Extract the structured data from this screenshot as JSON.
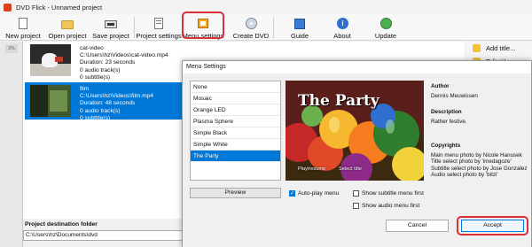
{
  "window": {
    "title": "DVD Flick - Unnamed project"
  },
  "toolbar": {
    "new_project": "New project",
    "open_project": "Open project",
    "save_project": "Save project",
    "project_settings": "Project settings",
    "menu_settings": "Menu settings",
    "create_dvd": "Create DVD",
    "guide": "Guide",
    "about": "About",
    "update": "Update"
  },
  "strip": {
    "marker": "2%"
  },
  "titles": [
    {
      "name": "cat-video",
      "path": "C:\\Users\\hz\\Videos\\cat-video.mp4",
      "duration": "Duration: 23 seconds",
      "audio": "0 audio track(s)",
      "subtitle": "0 subtitle(s)"
    },
    {
      "name": "film",
      "path": "C:\\Users\\hz\\Videos\\film.mp4",
      "duration": "Duration: 48 seconds",
      "audio": "0 audio track(s)",
      "subtitle": "0 subtitle(s)"
    }
  ],
  "right_panel": {
    "add_title": "Add title...",
    "edit_title": "Edit title..."
  },
  "destination": {
    "label": "Project destination folder",
    "value": "C:\\Users\\hz\\Documents\\dvd"
  },
  "dialog": {
    "title": "Menu Settings",
    "menus": [
      "None",
      "Mosaic",
      "Orange LED",
      "Plasma Sphere",
      "Simple Black",
      "Simple White",
      "The Party"
    ],
    "selected_index": 6,
    "preview_button": "Preview",
    "preview": {
      "heading": "The Party",
      "play": "Play/resume",
      "select": "Select title"
    },
    "autoplay": "Auto-play menu",
    "subtitle_first": "Show subtitle menu first",
    "audio_first": "Show audio menu first",
    "author_h": "Author",
    "author": "Dennis Meuwissen",
    "description_h": "Description",
    "description": "Rather festive.",
    "copyrights_h": "Copyrights",
    "copyrights": [
      "Main menu photo by Nicole Hanusek",
      "Title select photo by 'imedagoze'",
      "Subtitle select photo by Jose Gonzalez",
      "Audio select photo by 'bitzi'"
    ],
    "cancel": "Cancel",
    "accept": "Accept"
  },
  "colors": {
    "accent": "#0078d7",
    "highlight": "#d9303a",
    "icon_yellow": "#f3c13a"
  }
}
